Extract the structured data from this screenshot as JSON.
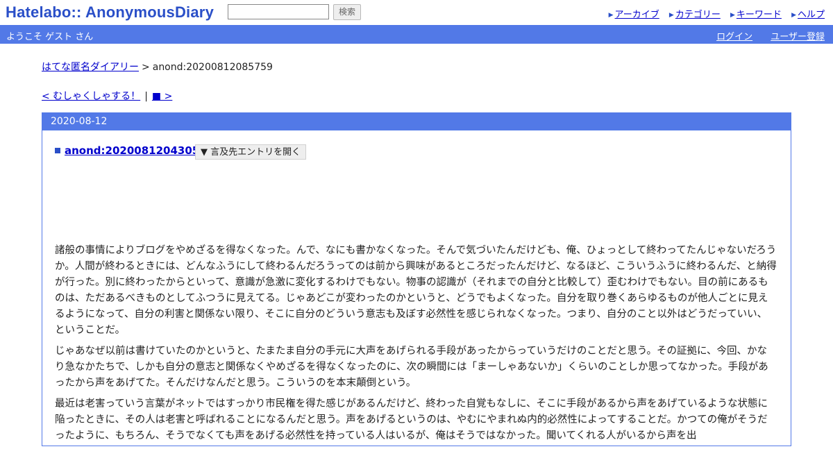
{
  "header": {
    "logo": "Hatelabo:: AnonymousDiary",
    "search_placeholder": "",
    "search_button": "検索",
    "nav": [
      {
        "label": "アーカイブ"
      },
      {
        "label": "カテゴリー"
      },
      {
        "label": "キーワード"
      },
      {
        "label": "ヘルプ"
      }
    ]
  },
  "welcome": {
    "text": "ようこそ ゲスト さん",
    "login": "ログイン",
    "register": "ユーザー登録"
  },
  "breadcrumb": {
    "home": "はてな匿名ダイアリー",
    "separator": ">",
    "current": "anond:20200812085759"
  },
  "pager": {
    "prev": "< むしゃくしゃする！",
    "separator": "|",
    "next": "■ >"
  },
  "entry": {
    "date": "2020-08-12",
    "bullet": "■",
    "title": "anond:20200812043056",
    "mention_button": "▼ 言及先エントリを開く",
    "paragraphs": [
      "諸般の事情によりブログをやめざるを得なくなった。んで、なにも書かなくなった。そんで気づいたんだけども、俺、ひょっとして終わってたんじゃないだろうか。人間が終わるときには、どんなふうにして終わるんだろうってのは前から興味があるところだったんだけど、なるほど、こういうふうに終わるんだ、と納得が行った。別に終わったからといって、意識が急激に変化するわけでもない。物事の認識が（それまでの自分と比較して）歪むわけでもない。目の前にあるものは、ただあるべきものとしてふつうに見えてる。じゃあどこが変わったのかというと、どうでもよくなった。自分を取り巻くあらゆるものが他人ごとに見えるようになって、自分の利害と関係ない限り、そこに自分のどういう意志も及ぼす必然性を感じられなくなった。つまり、自分のこと以外はどうだっていい、ということだ。",
      "じゃあなぜ以前は書けていたのかというと、たまたま自分の手元に大声をあげられる手段があったからっていうだけのことだと思う。その証拠に、今回、かなり急なかたちで、しかも自分の意志と関係なくやめざるを得なくなったのに、次の瞬間には「まーしゃあないか」くらいのことしか思ってなかった。手段があったから声をあげてた。そんだけなんだと思う。こういうのを本末顛倒という。",
      "最近は老害っていう言葉がネットではすっかり市民権を得た感じがあるんだけど、終わった自覚もなしに、そこに手段があるから声をあげているような状態に陥ったときに、その人は老害と呼ばれることになるんだと思う。声をあげるというのは、やむにやまれぬ内的必然性によってすることだ。かつての俺がそうだったように、もちろん、そうでなくても声をあげる必然性を持っている人はいるが、俺はそうではなかった。聞いてくれる人がいるから声を出"
    ]
  }
}
